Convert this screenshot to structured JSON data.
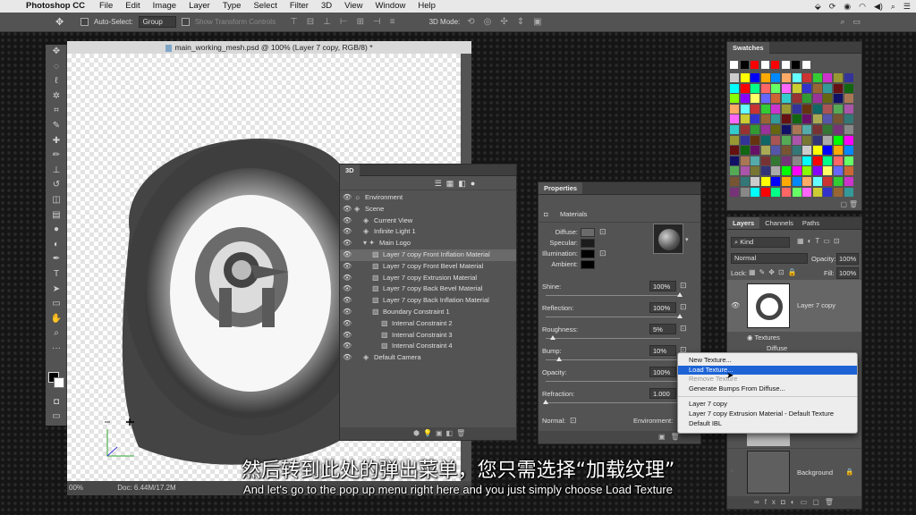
{
  "menubar": {
    "app": "Photoshop CC",
    "items": [
      "File",
      "Edit",
      "Image",
      "Layer",
      "Type",
      "Select",
      "Filter",
      "3D",
      "View",
      "Window",
      "Help"
    ]
  },
  "options": {
    "auto_select": "Auto-Select:",
    "group": "Group",
    "show_transform": "Show Transform Controls",
    "mode_3d": "3D Mode:"
  },
  "document": {
    "tab_title": "main_working_mesh.psd @ 100% (Layer 7 copy, RGB/8) *",
    "zoom": "00%",
    "doc_info": "Doc: 6.44M/17.2M"
  },
  "panel3d": {
    "title": "3D",
    "items": [
      {
        "label": "Environment",
        "indent": 0
      },
      {
        "label": "Scene",
        "indent": 0
      },
      {
        "label": "Current View",
        "indent": 1
      },
      {
        "label": "Infinite Light 1",
        "indent": 1
      },
      {
        "label": "Main Logo",
        "indent": 1
      },
      {
        "label": "Layer 7 copy Front Inflation Material",
        "indent": 2
      },
      {
        "label": "Layer 7 copy Front Bevel Material",
        "indent": 2
      },
      {
        "label": "Layer 7 copy Extrusion Material",
        "indent": 2
      },
      {
        "label": "Layer 7 copy Back Bevel Material",
        "indent": 2
      },
      {
        "label": "Layer 7 copy Back Inflation Material",
        "indent": 2
      },
      {
        "label": "Boundary Constraint 1",
        "indent": 2
      },
      {
        "label": "Internal Constraint 2",
        "indent": 3
      },
      {
        "label": "Internal Constraint 3",
        "indent": 3
      },
      {
        "label": "Internal Constraint 4",
        "indent": 3
      },
      {
        "label": "Default Camera",
        "indent": 1
      }
    ]
  },
  "properties": {
    "title": "Properties",
    "section": "Materials",
    "diffuse": "Diffuse:",
    "specular": "Specular:",
    "illumination": "Illumination:",
    "ambient": "Ambient:",
    "shine": {
      "label": "Shine:",
      "value": "100%",
      "level": 1.0
    },
    "reflection": {
      "label": "Reflection:",
      "value": "100%",
      "level": 1.0
    },
    "roughness": {
      "label": "Roughness:",
      "value": "5%",
      "level": 0.05
    },
    "bump": {
      "label": "Bump:",
      "value": "10%",
      "level": 0.1
    },
    "opacity": {
      "label": "Opacity:",
      "value": "100%",
      "level": 1.0
    },
    "refraction": {
      "label": "Refraction:",
      "value": "1.000",
      "level": 0.0
    },
    "normal": "Normal:",
    "environment": "Environment:"
  },
  "swatches": {
    "title": "Swatches"
  },
  "layers": {
    "tabs": [
      "Layers",
      "Channels",
      "Paths"
    ],
    "kind": "Kind",
    "blend": "Normal",
    "opacity_label": "Opacity:",
    "opacity": "100%",
    "lock_label": "Lock:",
    "fill_label": "Fill:",
    "fill": "100%",
    "layer_name": "Layer 7 copy",
    "textures": "Textures",
    "diffuse": "Diffuse",
    "background": "Background"
  },
  "context_menu": {
    "items": [
      {
        "label": "New Texture...",
        "state": "normal"
      },
      {
        "label": "Load Texture...",
        "state": "highlight"
      },
      {
        "label": "Remove Texture",
        "state": "disabled"
      },
      {
        "label": "Generate Bumps From Diffuse...",
        "state": "normal"
      },
      {
        "label": "Layer 7 copy",
        "state": "normal",
        "sep": true
      },
      {
        "label": "Layer 7 copy Extrusion Material - Default Texture",
        "state": "normal"
      },
      {
        "label": "Default IBL",
        "state": "normal"
      }
    ]
  },
  "subtitle": {
    "zh": "然后转到此处的弹出菜单，您只需选择“加载纹理”",
    "en": "And let's go to the pop up menu right here and you just simply choose Load Texture"
  }
}
